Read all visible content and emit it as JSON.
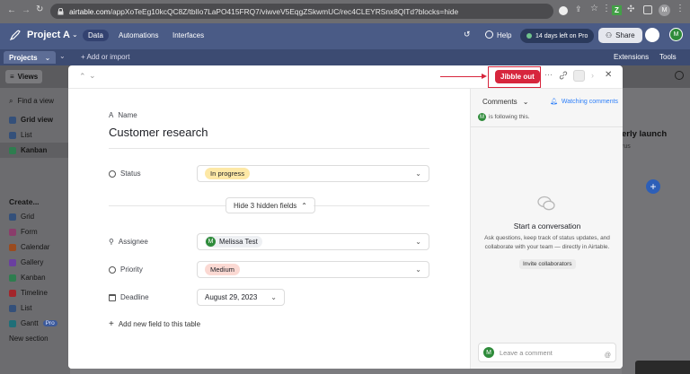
{
  "browser": {
    "url_host": "airtable.com",
    "url_path": "/appXoTeEg10kcQC8Z/tblIo7LaPO415FRQ7/viwveV5EqgZSkwmUC/rec4CLEYRSnx8QlTd?blocks=hide",
    "profile_initial": "M"
  },
  "app": {
    "project_name": "Project A",
    "tabs": [
      "Data",
      "Automations",
      "Interfaces"
    ],
    "help": "Help",
    "trial": "14 days left on Pro",
    "share": "Share",
    "user_initial": "M"
  },
  "subbar": {
    "projects": "Projects",
    "add_import": "Add or import",
    "extensions": "Extensions",
    "tools": "Tools"
  },
  "views": {
    "label": "Views",
    "find_placeholder": "Find a view",
    "items": [
      "Grid view",
      "List",
      "Kanban"
    ],
    "create_label": "Create...",
    "create_items": [
      "Grid",
      "Form",
      "Calendar",
      "Gallery",
      "Kanban",
      "Timeline",
      "List",
      "Gantt",
      "New section"
    ],
    "pro_badge": "Pro"
  },
  "background": {
    "kanban_title": "erly launch",
    "kanban_sub": "rus"
  },
  "record": {
    "jibble_button": "Jibble out",
    "name_label": "Name",
    "name_value": "Customer research",
    "status_label": "Status",
    "status_value": "In progress",
    "hidden_fields": "Hide 3 hidden fields",
    "assignee_label": "Assignee",
    "assignee_value": "Melissa Test",
    "assignee_initial": "M",
    "priority_label": "Priority",
    "priority_value": "Medium",
    "deadline_label": "Deadline",
    "deadline_value": "August 29, 2023",
    "add_field": "Add new field to this table"
  },
  "comments": {
    "header": "Comments",
    "watching": "Watching comments",
    "following": "is following this.",
    "following_initial": "M",
    "empty_title": "Start a conversation",
    "empty_body": "Ask questions, keep track of status updates, and collaborate with your team — directly in Airtable.",
    "invite": "Invite collaborators",
    "input_placeholder": "Leave a comment",
    "input_initial": "M"
  },
  "colors": {
    "header_blue": "#4a5b86",
    "jibble_red": "#d7263d",
    "status_pill": "#fde8a6",
    "priority_pill": "#fbd9d3",
    "avatar_green": "#2e8b3a",
    "link_blue": "#2d7ff9"
  }
}
